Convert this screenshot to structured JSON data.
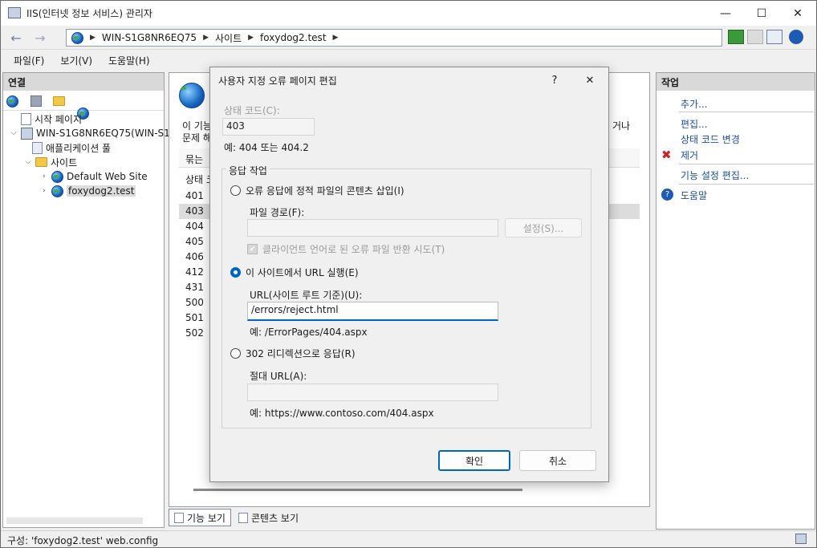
{
  "window": {
    "title": "IIS(인터넷 정보 서비스) 관리자",
    "minimize": "—",
    "maximize": "☐",
    "close": "✕"
  },
  "address": {
    "back": "←",
    "forward": "→",
    "crumbs": [
      "WIN-S1G8NR6EQ75",
      "사이트",
      "foxydog2.test"
    ],
    "separator": "▶"
  },
  "menu": [
    "파일(F)",
    "보기(V)",
    "도움말(H)"
  ],
  "left_pane": {
    "header": "연결",
    "tree": [
      {
        "label": "시작 페이지"
      },
      {
        "label": "WIN-S1G8NR6EQ75(WIN-S1"
      },
      {
        "label": "애플리케이션 풀"
      },
      {
        "label": "사이트"
      },
      {
        "label": "Default Web Site"
      },
      {
        "label": "foxydog2.test"
      }
    ]
  },
  "center_pane": {
    "desc_line1": "이 기능",
    "desc_line2": "문제 해",
    "desc_right": "거나",
    "group_header": "묶는 ",
    "column_header": "상태 코",
    "codes": [
      "401",
      "403",
      "404",
      "405",
      "406",
      "412",
      "431",
      "500",
      "501",
      "502"
    ],
    "selected_code": "403"
  },
  "right_pane": {
    "header": "작업",
    "actions": {
      "add": "추가...",
      "edit": "편집...",
      "change_status": "상태 코드 변경",
      "remove": "제거",
      "feature_settings": "기능 설정 편집...",
      "help": "도움말"
    }
  },
  "view_tabs": {
    "features": "기능 보기",
    "content": "콘텐츠 보기"
  },
  "status_bar": {
    "text": "구성: 'foxydog2.test' web.config"
  },
  "dialog": {
    "title": "사용자 지정 오류 페이지 편집",
    "help_btn": "?",
    "close_btn": "✕",
    "status_code_label": "상태 코드(C):",
    "status_code_value": "403",
    "status_code_example": "예: 404 또는 404.2",
    "response_group_title": "응답 작업",
    "option_static": "오류 응답에 정적 파일의 콘텐츠 삽입(I)",
    "file_path_label": "파일 경로(F):",
    "file_path_value": "",
    "settings_btn": "설정(S)...",
    "try_client_lang": "클라이언트 언어로 된 오류 파일 반환 시도(T)",
    "option_url": "이 사이트에서 URL 실행(E)",
    "url_label": "URL(사이트 루트 기준)(U):",
    "url_value": "/errors/reject.html",
    "url_example": "예: /ErrorPages/404.aspx",
    "option_redirect": "302 리디렉션으로 응답(R)",
    "abs_url_label": "절대 URL(A):",
    "abs_url_value": "",
    "abs_url_example": "예: https://www.contoso.com/404.aspx",
    "ok": "확인",
    "cancel": "취소",
    "selected_option": "url"
  }
}
